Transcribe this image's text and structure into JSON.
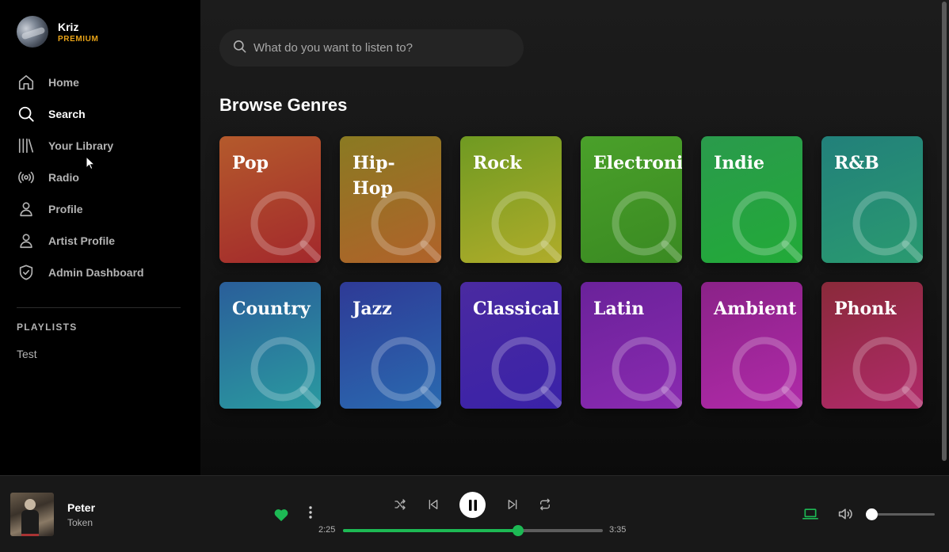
{
  "user": {
    "name": "Kriz",
    "tier": "PREMIUM"
  },
  "nav": [
    {
      "label": "Home",
      "icon": "home-icon"
    },
    {
      "label": "Search",
      "icon": "search-icon",
      "active": true
    },
    {
      "label": "Your Library",
      "icon": "library-icon"
    },
    {
      "label": "Radio",
      "icon": "radio-icon"
    },
    {
      "label": "Profile",
      "icon": "person-icon"
    },
    {
      "label": "Artist Profile",
      "icon": "person-icon"
    },
    {
      "label": "Admin Dashboard",
      "icon": "shield-icon"
    }
  ],
  "playlists": {
    "heading": "PLAYLISTS",
    "items": [
      "Test"
    ]
  },
  "search": {
    "placeholder": "What do you want to listen to?"
  },
  "browse": {
    "title": "Browse Genres",
    "genres": [
      {
        "name": "Pop",
        "colors": [
          "#b45a2c",
          "#a3282c"
        ]
      },
      {
        "name": "Hip-Hop",
        "colors": [
          "#8a7a22",
          "#b0622a"
        ]
      },
      {
        "name": "Rock",
        "colors": [
          "#6f9a22",
          "#b0ac2a"
        ]
      },
      {
        "name": "Electronic",
        "colors": [
          "#4aa02a",
          "#3a8a22"
        ]
      },
      {
        "name": "Indie",
        "colors": [
          "#2a9a4c",
          "#22aa38"
        ]
      },
      {
        "name": "R&B",
        "colors": [
          "#22807a",
          "#2a9a70"
        ]
      },
      {
        "name": "Country",
        "colors": [
          "#2a5e9a",
          "#2a9aa0"
        ]
      },
      {
        "name": "Jazz",
        "colors": [
          "#2e3a96",
          "#2a6ab0"
        ]
      },
      {
        "name": "Classical",
        "colors": [
          "#4a2aa0",
          "#3a22a8"
        ]
      },
      {
        "name": "Latin",
        "colors": [
          "#6a229a",
          "#8a2ab0"
        ]
      },
      {
        "name": "Ambient",
        "colors": [
          "#8a2288",
          "#b02aa8"
        ]
      },
      {
        "name": "Phonk",
        "colors": [
          "#8a2a3a",
          "#b02a6a"
        ]
      }
    ]
  },
  "player": {
    "title": "Peter",
    "artist": "Token",
    "liked": true,
    "elapsed": "2:25",
    "duration": "3:35",
    "progress_fraction": 0.674,
    "volume_fraction": 0.06,
    "accent": "#1db954"
  }
}
